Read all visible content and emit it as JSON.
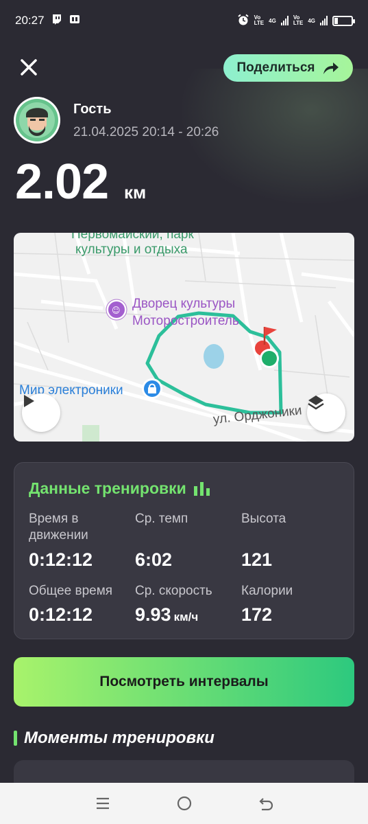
{
  "status_bar": {
    "time": "20:27",
    "net1": [
      "Vo",
      "LTE"
    ],
    "net2": [
      "Vo",
      "LTE"
    ],
    "sig1": "4G",
    "sig2": "4G"
  },
  "header": {
    "share_label": "Поделиться",
    "user_name": "Гость",
    "date_range": "21.04.2025 20:14 - 20:26",
    "distance": "2.02",
    "distance_unit": "км"
  },
  "map": {
    "labels": {
      "park_line1": "Первомайский, парк",
      "park_line2": "культуры и отдыха",
      "palace_line1": "Дворец культуры",
      "palace_line2": "Моторостроитель",
      "store": "Мир электроники",
      "street": "ул. Орджоники"
    },
    "route_color": "#2cbf9a",
    "start_color": "#1fae6a",
    "finish_color": "#e8433c"
  },
  "stats": {
    "title": "Данные тренировки",
    "accent": "#74e36f",
    "moving_time_label_1": "Время в",
    "moving_time_label_2": "движении",
    "moving_time": "0:12:12",
    "avg_pace_label": "Ср. темп",
    "avg_pace": "6:02",
    "elevation_label": "Высота",
    "elevation": "121",
    "total_time_label": "Общее время",
    "total_time": "0:12:12",
    "avg_speed_label": "Ср. скорость",
    "avg_speed": "9.93",
    "avg_speed_unit": "км/ч",
    "calories_label": "Калории",
    "calories": "172"
  },
  "intervals_label": "Посмотреть интервалы",
  "moments_title": "Моменты тренировки",
  "icons": [
    "twitch-icon",
    "app-icon",
    "alarm-icon",
    "battery-icon",
    "close-icon",
    "share-arrow-icon",
    "avatar",
    "play-icon",
    "layers-icon",
    "bar-chart-icon",
    "menu-icon",
    "home-icon",
    "back-icon"
  ]
}
